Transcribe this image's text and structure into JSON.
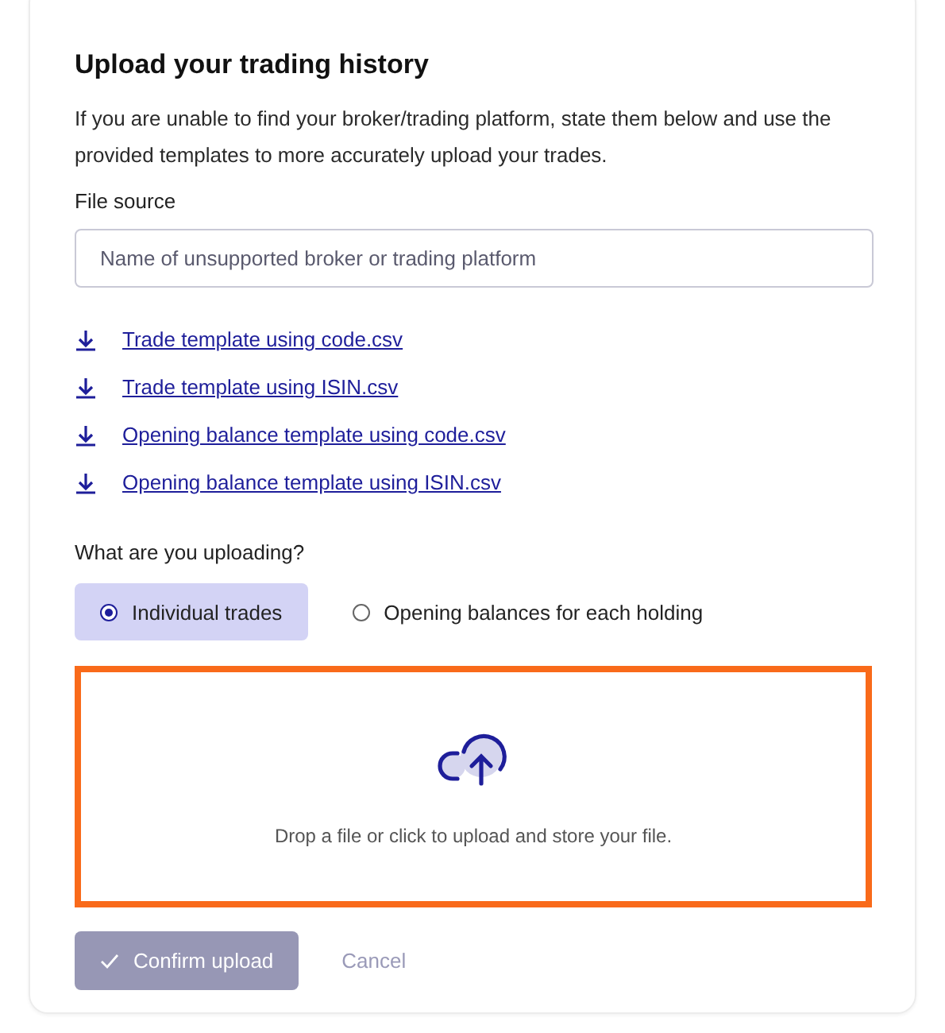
{
  "title": "Upload your trading history",
  "description": "If you are unable to find your broker/trading platform, state them below and use the provided templates to more accurately upload your trades.",
  "file_source": {
    "label": "File source",
    "placeholder": "Name of unsupported broker or trading platform"
  },
  "templates": [
    {
      "label": "Trade template using code.csv"
    },
    {
      "label": "Trade template using ISIN.csv"
    },
    {
      "label": "Opening balance template using code.csv"
    },
    {
      "label": "Opening balance template using ISIN.csv"
    }
  ],
  "upload_type": {
    "label": "What are you uploading?",
    "options": [
      {
        "label": "Individual trades",
        "selected": true
      },
      {
        "label": "Opening balances for each holding",
        "selected": false
      }
    ]
  },
  "dropzone": {
    "text": "Drop a file or click to upload and store your file.",
    "highlighted": true
  },
  "buttons": [
    {
      "kind": "primary",
      "label": "Confirm upload",
      "disabled": true
    },
    {
      "kind": "link",
      "label": "Cancel",
      "disabled": true
    }
  ]
}
